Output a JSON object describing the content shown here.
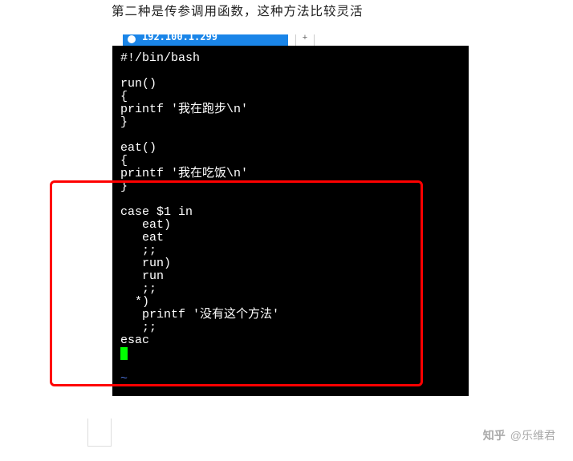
{
  "heading": "第二种是传参调用函数，这种方法比较灵活",
  "tab": {
    "ip_fragment": "192.100.1.299",
    "plus": "+"
  },
  "code": {
    "l1": "#!/bin/bash",
    "l2": "",
    "l3": "run()",
    "l4": "{",
    "l5": "printf '我在跑步\\n'",
    "l6": "}",
    "l7": "",
    "l8": "eat()",
    "l9": "{",
    "l10": "printf '我在吃饭\\n'",
    "l11": "}",
    "l12": "",
    "l13": "case $1 in",
    "l14": "   eat)",
    "l15": "   eat",
    "l16": "   ;;",
    "l17": "   run)",
    "l18": "   run",
    "l19": "   ;;",
    "l20": "  *)",
    "l21": "   printf '没有这个方法'",
    "l22": "   ;;",
    "l23": "esac",
    "tilde": "~"
  },
  "watermark": {
    "logo": "知乎",
    "author": "@乐维君"
  }
}
